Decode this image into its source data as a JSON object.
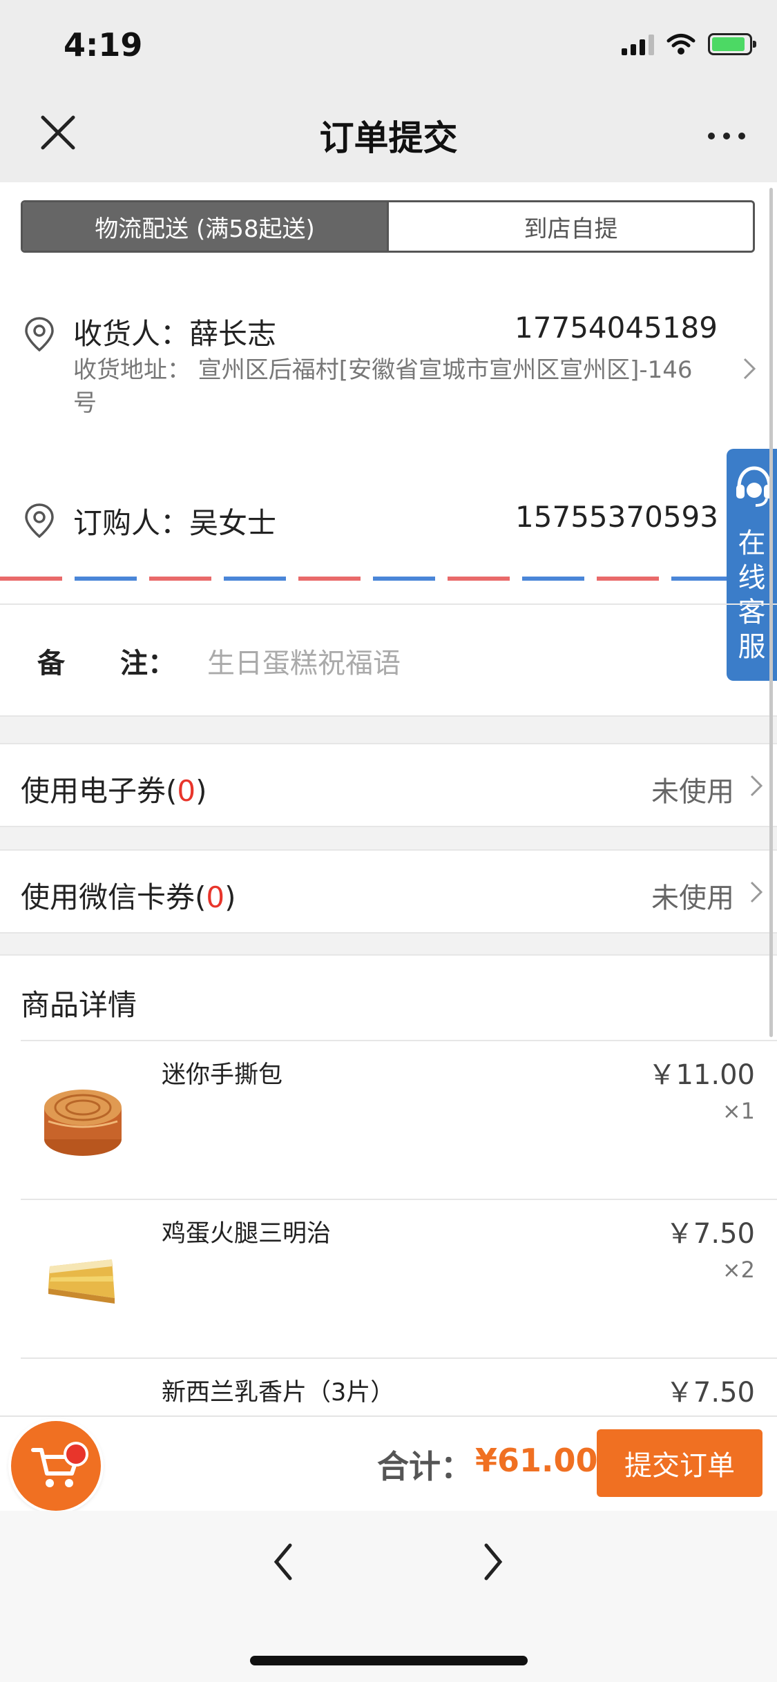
{
  "status_bar": {
    "time": "4:19"
  },
  "nav": {
    "title": "订单提交"
  },
  "delivery_tabs": [
    {
      "label": "物流配送 (满58起送)",
      "active": true
    },
    {
      "label": "到店自提",
      "active": false
    }
  ],
  "recipient": {
    "label": "收货人：薛长志",
    "phone": "17754045189",
    "address_line1": "收货地址： 宣州区后福村[安徽省宣城市宣州区宣州区]-146",
    "address_line2": "号"
  },
  "orderer": {
    "label": "订购人：吴女士",
    "phone": "15755370593"
  },
  "online_service": {
    "label": "在线客服"
  },
  "remark": {
    "label": "备　　注：",
    "placeholder": "生日蛋糕祝福语"
  },
  "coupons": [
    {
      "prefix": "使用电子券(",
      "count": "0",
      "suffix": ")",
      "status": "未使用"
    },
    {
      "prefix": "使用微信卡券(",
      "count": "0",
      "suffix": ")",
      "status": "未使用"
    }
  ],
  "products": {
    "header": "商品详情",
    "items": [
      {
        "name": "迷你手撕包",
        "price": "￥11.00",
        "qty": "×1"
      },
      {
        "name": "鸡蛋火腿三明治",
        "price": "￥7.50",
        "qty": "×2"
      },
      {
        "name": "新西兰乳香片（3片）",
        "price": "￥7.50"
      }
    ]
  },
  "footer": {
    "total_label": "合计：",
    "total_value": "¥61.00",
    "submit_label": "提交订单"
  },
  "colors": {
    "accent": "#f07022",
    "count_red": "#e8352b",
    "service_blue": "#3b7dc9"
  },
  "icons": [
    "close-icon",
    "more-icon",
    "location-pin-icon",
    "chevron-right-icon",
    "headset-icon",
    "cart-icon",
    "back-arrow-icon",
    "forward-arrow-icon"
  ]
}
